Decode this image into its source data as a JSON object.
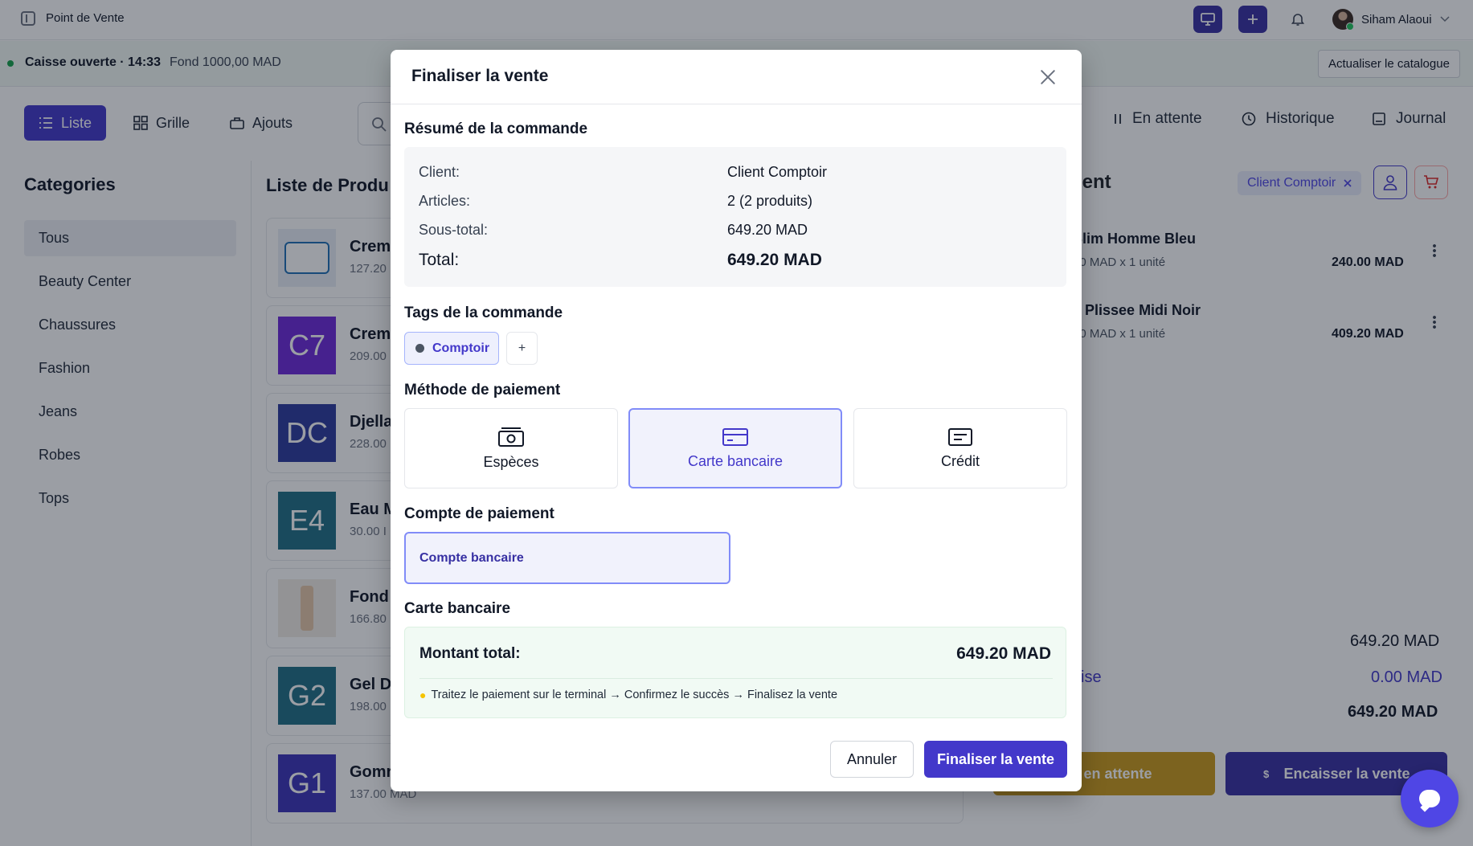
{
  "app": {
    "title": "Point de Vente"
  },
  "user": {
    "name": "Siham Alaoui"
  },
  "status": {
    "text": "Caisse ouverte · 14:33",
    "fond": "Fond 1000,00 MAD",
    "refresh_label": "Actualiser le catalogue"
  },
  "view": {
    "list_label": "Liste",
    "grid_label": "Grille",
    "addons_label": "Ajouts"
  },
  "categories": {
    "title": "Categories",
    "items": [
      "Tous",
      "Beauty Center",
      "Chaussures",
      "Fashion",
      "Jeans",
      "Robes",
      "Tops"
    ]
  },
  "products": {
    "title": "Liste de Produ",
    "items": [
      {
        "name": "Crem",
        "price": "127.20",
        "thumb": "",
        "color": "#e8eef7"
      },
      {
        "name": "Crem",
        "price": "209.00",
        "thumb": "C7",
        "color": "#6d28d9"
      },
      {
        "name": "Djella",
        "price": "228.00",
        "thumb": "DC",
        "color": "#2b3a9e"
      },
      {
        "name": "Eau M",
        "price": "30.00 I",
        "thumb": "E4",
        "color": "#1f6f86"
      },
      {
        "name": "Fond",
        "price": "166.80",
        "thumb": "",
        "color": "#f1ece6"
      },
      {
        "name": "Gel D",
        "price": "198.00",
        "thumb": "G2",
        "color": "#1f6f86"
      },
      {
        "name": "Gomr",
        "price": "137.00 MAD",
        "thumb": "G1",
        "color": "#3b32b8"
      }
    ]
  },
  "right_panel": {
    "tabs": [
      "En attente",
      "Historique",
      "Journal"
    ],
    "title": "ient",
    "client_chip": "Client Comptoir",
    "lines": [
      {
        "name": "Slim Homme Bleu",
        "meta": "00 MAD x 1 unité",
        "total": "240.00 MAD"
      },
      {
        "name": "e Plissee Midi Noir",
        "meta": "20 MAD x 1 unité",
        "total": "409.20 MAD"
      }
    ],
    "sum_subtotal": "649.20 MAD",
    "discount_label": "ise",
    "sum_discount": "0.00 MAD",
    "sum_total": "649.20 MAD",
    "hold_label": "ttre en attente",
    "pay_label": "Encaisser la vente"
  },
  "modal": {
    "title": "Finaliser la vente",
    "summary_title": "Résumé de la commande",
    "summary": {
      "client_label": "Client:",
      "client_value": "Client Comptoir",
      "articles_label": "Articles:",
      "articles_value": "2 (2 produits)",
      "subtotal_label": "Sous-total:",
      "subtotal_value": "649.20 MAD",
      "total_label": "Total:",
      "total_value": "649.20 MAD"
    },
    "tags_title": "Tags de la commande",
    "tag_chip": "Comptoir",
    "tag_add": "+",
    "payment_title": "Méthode de paiement",
    "payment_methods": [
      "Espèces",
      "Carte bancaire",
      "Crédit"
    ],
    "selected_method": "Carte bancaire",
    "account_title": "Compte de paiement",
    "account_value": "Compte bancaire",
    "card_title": "Carte bancaire",
    "card_amount_label": "Montant total:",
    "card_amount_value": "649.20 MAD",
    "card_hint": "Traitez le paiement sur le terminal → Confirmez le succès → Finalisez la vente",
    "cancel_label": "Annuler",
    "confirm_label": "Finaliser la vente"
  },
  "colors": {
    "accent": "#4338ca",
    "overlay": "rgba(17,24,39,0.42)",
    "success": "#16a34a",
    "warning": "#ca9a1a"
  }
}
